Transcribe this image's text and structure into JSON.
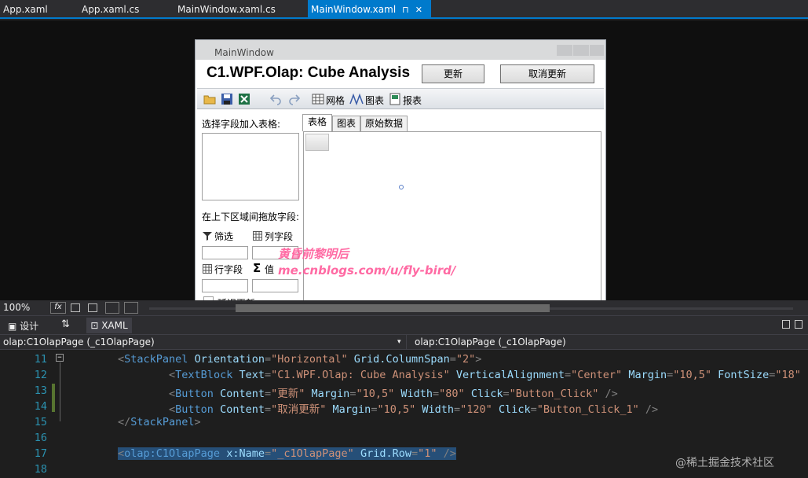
{
  "tabs": [
    {
      "label": "App.xaml"
    },
    {
      "label": "App.xaml.cs"
    },
    {
      "label": "MainWindow.xaml.cs"
    },
    {
      "label": "MainWindow.xaml",
      "active": true
    }
  ],
  "tab_controls": {
    "pin": "⊓",
    "close": "✕"
  },
  "window": {
    "title": "MainWindow",
    "app_title": "C1.WPF.Olap: Cube Analysis",
    "refresh_label": "更新",
    "cancel_label": "取消更新",
    "toolbar": {
      "grid_label": "网格",
      "chart_label": "图表",
      "report_label": "报表"
    },
    "left": {
      "choose_fields": "选择字段加入表格:",
      "drag_fields": "在上下区域间拖放字段:",
      "filter": "筛选",
      "columns": "列字段",
      "rows": "行字段",
      "values": "值",
      "defer": "延迟更新"
    },
    "content_tabs": [
      {
        "label": "表格"
      },
      {
        "label": "图表"
      },
      {
        "label": "原始数据"
      }
    ]
  },
  "watermark": {
    "line1": "黄昏前黎明后",
    "line2": "me.cnblogs.com/u/fly-bird/"
  },
  "status": {
    "zoom": "100%"
  },
  "splitter": {
    "design": "设计",
    "swap": "⇅",
    "xaml": "XAML"
  },
  "nav": {
    "left": "olap:C1OlapPage (_c1OlapPage)",
    "right": "olap:C1OlapPage (_c1OlapPage)"
  },
  "code_lines": [
    {
      "n": "11",
      "text": "<StackPanel Orientation=\"Horizontal\" Grid.ColumnSpan=\"2\">"
    },
    {
      "n": "12",
      "text": "    <TextBlock Text=\"C1.WPF.Olap: Cube Analysis\" VerticalAlignment=\"Center\" Margin=\"10,5\" FontSize=\"18\" Fon"
    },
    {
      "n": "13",
      "text": "    <Button Content=\"更新\" Margin=\"10,5\" Width=\"80\" Click=\"Button_Click\" />"
    },
    {
      "n": "14",
      "text": "    <Button Content=\"取消更新\" Margin=\"10,5\" Width=\"120\" Click=\"Button_Click_1\" />"
    },
    {
      "n": "15",
      "text": "</StackPanel>"
    },
    {
      "n": "16",
      "text": ""
    },
    {
      "n": "17",
      "text": "<olap:C1OlapPage x:Name=\"_c1OlapPage\" Grid.Row=\"1\" />"
    },
    {
      "n": "18",
      "text": ""
    }
  ],
  "corner_watermark": "@稀土掘金技术社区"
}
